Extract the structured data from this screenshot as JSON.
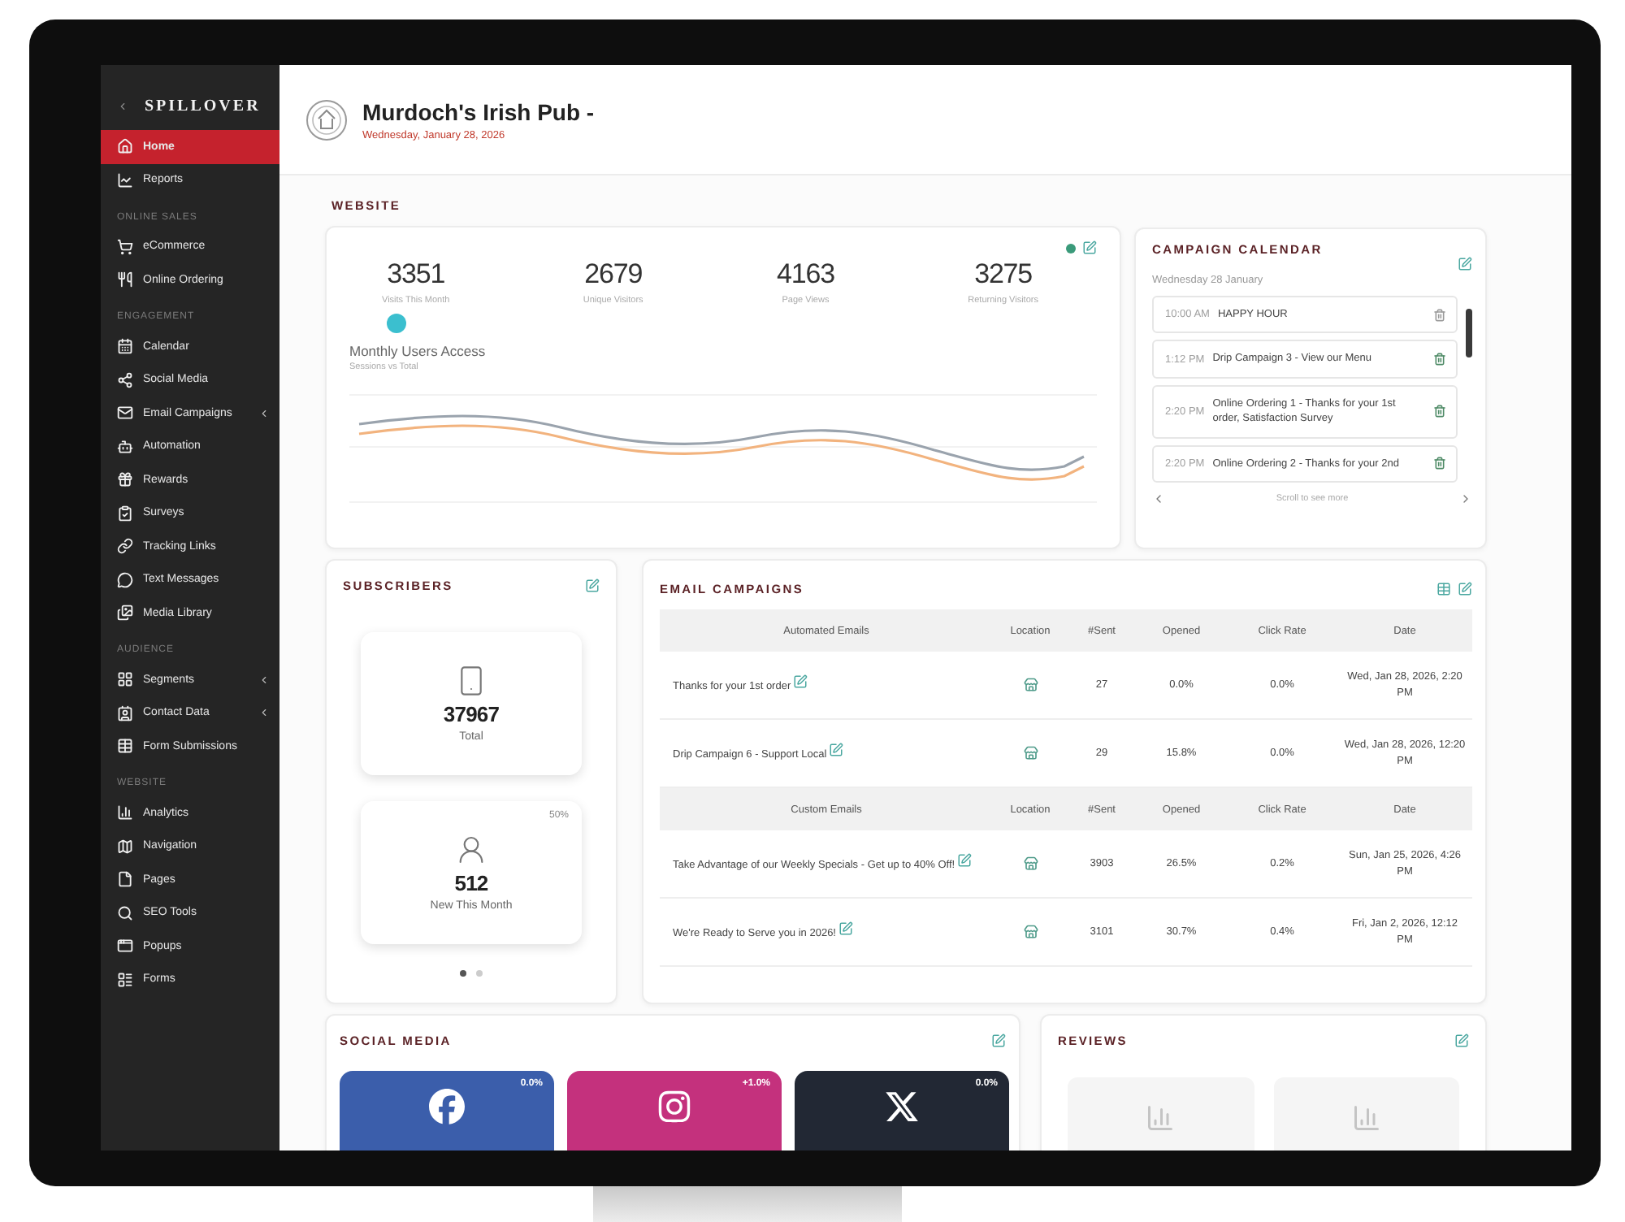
{
  "sidebar": {
    "logo": "SPILLOVER",
    "sections": [
      {
        "items": [
          {
            "label": "Home",
            "selected": true,
            "expandable": false
          },
          {
            "label": "Reports",
            "selected": false,
            "expandable": false
          }
        ]
      },
      {
        "heading": "ONLINE SALES",
        "items": [
          {
            "label": "eCommerce",
            "selected": false,
            "expandable": false
          },
          {
            "label": "Online Ordering",
            "selected": false,
            "expandable": false
          }
        ]
      },
      {
        "heading": "ENGAGEMENT",
        "items": [
          {
            "label": "Calendar",
            "selected": false,
            "expandable": false
          },
          {
            "label": "Social Media",
            "selected": false,
            "expandable": false
          },
          {
            "label": "Email Campaigns",
            "selected": false,
            "expandable": true
          },
          {
            "label": "Automation",
            "selected": false,
            "expandable": false
          },
          {
            "label": "Rewards",
            "selected": false,
            "expandable": false
          },
          {
            "label": "Surveys",
            "selected": false,
            "expandable": false
          },
          {
            "label": "Tracking Links",
            "selected": false,
            "expandable": false
          },
          {
            "label": "Text Messages",
            "selected": false,
            "expandable": false
          },
          {
            "label": "Media Library",
            "selected": false,
            "expandable": false
          }
        ]
      },
      {
        "heading": "AUDIENCE",
        "items": [
          {
            "label": "Segments",
            "selected": false,
            "expandable": true
          },
          {
            "label": "Contact Data",
            "selected": false,
            "expandable": true
          },
          {
            "label": "Form Submissions",
            "selected": false,
            "expandable": false
          }
        ]
      },
      {
        "heading": "WEBSITE",
        "items": [
          {
            "label": "Analytics",
            "selected": false,
            "expandable": false
          },
          {
            "label": "Navigation",
            "selected": false,
            "expandable": false
          },
          {
            "label": "Pages",
            "selected": false,
            "expandable": false
          },
          {
            "label": "SEO Tools",
            "selected": false,
            "expandable": false
          },
          {
            "label": "Popups",
            "selected": false,
            "expandable": false
          },
          {
            "label": "Forms",
            "selected": false,
            "expandable": false
          }
        ]
      }
    ]
  },
  "header": {
    "title": "Murdoch's Irish Pub -",
    "date": "Wednesday, January 28, 2026"
  },
  "website": {
    "title": "WEBSITE",
    "stats": [
      {
        "value": "3351",
        "label": "Visits This Month"
      },
      {
        "value": "2679",
        "label": "Unique Visitors"
      },
      {
        "value": "4163",
        "label": "Page Views"
      },
      {
        "value": "3275",
        "label": "Returning Visitors"
      }
    ],
    "chart": {
      "title": "Monthly Users Access",
      "subtitle": "Sessions vs Total"
    }
  },
  "campaign_calendar": {
    "title": "CAMPAIGN CALENDAR",
    "date": "Wednesday 28 January",
    "events": [
      {
        "time": "10:00 AM",
        "title": "HAPPY HOUR",
        "color": "#9a9a9a"
      },
      {
        "time": "1:12 PM",
        "title": "Drip Campaign 3 - View our Menu",
        "color": "#4e8a66"
      },
      {
        "time": "2:20 PM",
        "title": "Online Ordering 1 - Thanks for your 1st order, Satisfaction Survey",
        "color": "#4e8a66"
      },
      {
        "time": "2:20 PM",
        "title": "Online Ordering 2 - Thanks for your 2nd",
        "color": "#4e8a66"
      }
    ],
    "footer": "Scroll to see more"
  },
  "subscribers": {
    "title": "SUBSCRIBERS",
    "cards": [
      {
        "value": "37967",
        "label": "Total"
      },
      {
        "value": "512",
        "label": "New This Month",
        "badge": "50%"
      }
    ],
    "pages": [
      {
        "selected": true
      },
      {
        "selected": false
      }
    ]
  },
  "email_campaigns": {
    "title": "EMAIL CAMPAIGNS",
    "groups": [
      {
        "columns": [
          "Automated Emails",
          "Location",
          "#Sent",
          "Opened",
          "Click Rate",
          "Date"
        ],
        "rows": [
          {
            "name": "Thanks for your 1st order",
            "sent": "27",
            "opened": "0.0%",
            "click_rate": "0.0%",
            "date": "Wed, Jan 28, 2026, 2:20 PM"
          },
          {
            "name": "Drip Campaign 6 - Support Local",
            "sent": "29",
            "opened": "15.8%",
            "click_rate": "0.0%",
            "date": "Wed, Jan 28, 2026, 12:20 PM"
          }
        ]
      },
      {
        "columns": [
          "Custom Emails",
          "Location",
          "#Sent",
          "Opened",
          "Click Rate",
          "Date"
        ],
        "rows": [
          {
            "name": "Take Advantage of our Weekly Specials - Get up to 40% Off!",
            "sent": "3903",
            "opened": "26.5%",
            "click_rate": "0.2%",
            "date": "Sun, Jan 25, 2026, 4:26 PM"
          },
          {
            "name": "We're Ready to Serve you in 2026!",
            "sent": "3101",
            "opened": "30.7%",
            "click_rate": "0.4%",
            "date": "Fri, Jan 2, 2026, 12:12 PM"
          }
        ]
      }
    ]
  },
  "social_media": {
    "title": "SOCIAL MEDIA",
    "accounts": [
      {
        "kind": "facebook",
        "badge": "0.0%",
        "color": "#3b5eab"
      },
      {
        "kind": "instagram",
        "badge": "+1.0%",
        "color": "#c4317d"
      },
      {
        "kind": "x",
        "badge": "0.0%",
        "color": "#222834"
      }
    ]
  },
  "reviews": {
    "title": "REVIEWS"
  }
}
